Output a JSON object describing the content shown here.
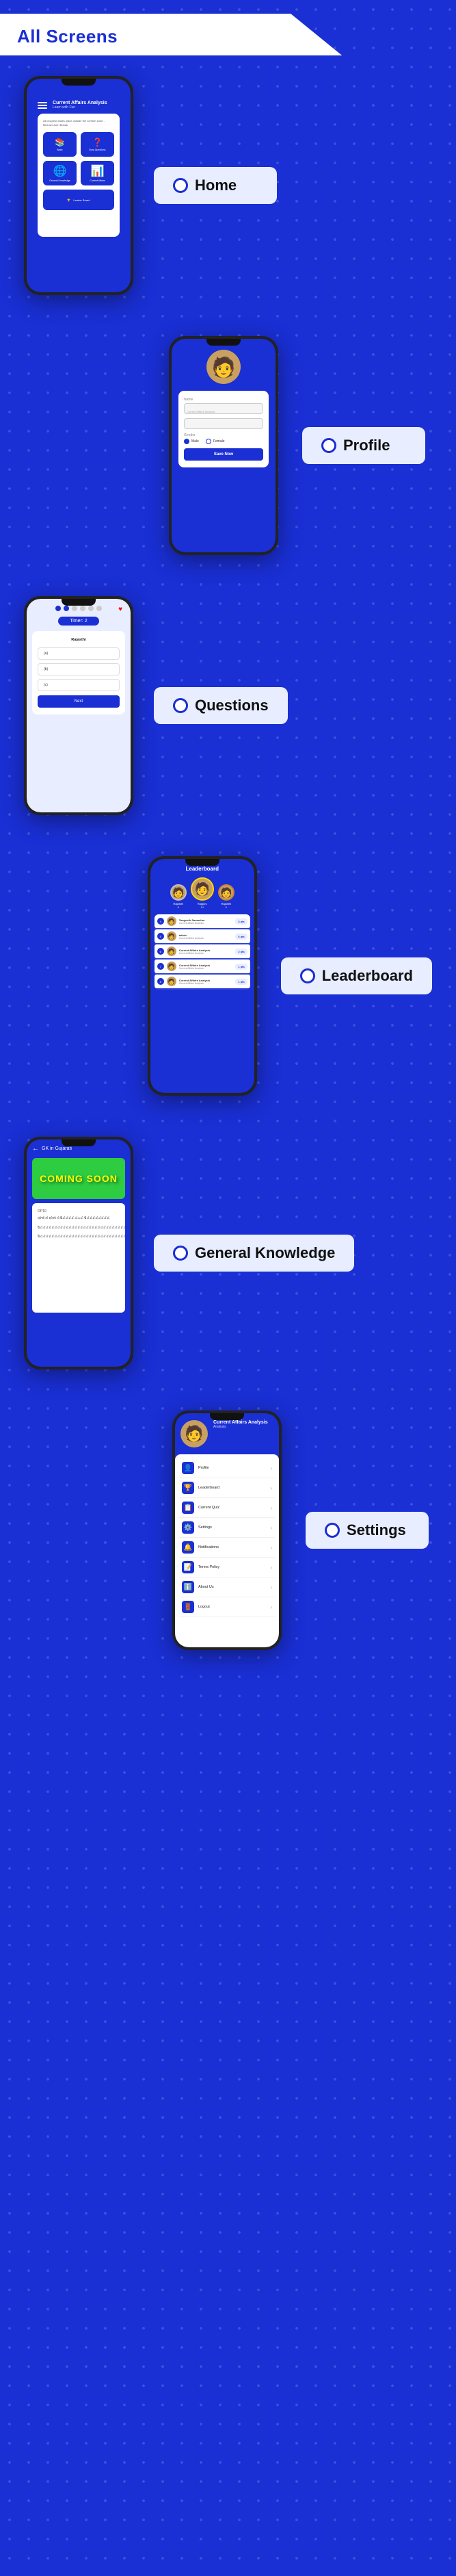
{
  "page": {
    "title": "All Screens",
    "background_color": "#1a2fd4"
  },
  "header": {
    "title": "All Screens"
  },
  "sections": {
    "home": {
      "label": "Home",
      "screen": {
        "title": "Current Affairs Analysis",
        "subtitle": "Learn with Fun",
        "quote": "All progress takes place outside the comfort zone. - Michael John Bobak",
        "menu_items": [
          {
            "icon": "📚",
            "label": "Basic"
          },
          {
            "icon": "❓",
            "label": "Bury Questions"
          },
          {
            "icon": "🌐",
            "label": "General Knowledge"
          },
          {
            "icon": "📊",
            "label": "Current Affairs"
          }
        ],
        "leaderboard_label": "Leader Board"
      }
    },
    "profile": {
      "label": "Profile",
      "screen": {
        "avatar_emoji": "🧑",
        "fields": [
          {
            "label": "Name",
            "placeholder": "Current Affairs Analysis"
          },
          {
            "label": "",
            "placeholder": ""
          }
        ],
        "gender_label": "Gender",
        "gender_options": [
          "Male",
          "Female"
        ],
        "save_button": "Save Now"
      }
    },
    "questions": {
      "label": "Questions",
      "screen": {
        "progress_dots": 6,
        "active_dot": 2,
        "timer": "Timer: 2",
        "question_text": "Rajasthi",
        "options": [
          "(a)",
          "(b)",
          "(c)"
        ],
        "next_button": "Next"
      }
    },
    "leaderboard": {
      "label": "Leaderboard",
      "screen": {
        "title": "Leaderboard",
        "top3": [
          {
            "rank": 2,
            "name": "Rajasthi Samachar",
            "score": "8",
            "emoji": "🧑"
          },
          {
            "rank": 1,
            "name": "Rajguru12345678",
            "score": "14",
            "emoji": "🧑"
          },
          {
            "rank": 3,
            "name": "Rajasthi Samachar",
            "score": "5",
            "emoji": "🧑"
          }
        ],
        "list": [
          {
            "rank": "4",
            "name": "Tangeeth Samachar",
            "sub": "Current Affairs Analysis",
            "score": "3 pts",
            "emoji": "🧑"
          },
          {
            "rank": "5",
            "name": "admin",
            "sub": "Current Affairs Analysis",
            "score": "6 pts",
            "emoji": "🧑"
          },
          {
            "rank": "6",
            "name": "Current Affairs Analysis",
            "sub": "Current Affairs Analysis",
            "score": "2 pts",
            "emoji": "🧑"
          },
          {
            "rank": "7",
            "name": "Current Affairs Analysis",
            "sub": "Current Affairs Analysis",
            "score": "1 pts",
            "emoji": "🧑"
          },
          {
            "rank": "8",
            "name": "Current Affairs Analysis",
            "sub": "Current Affairs Analysis",
            "score": "1 pts",
            "emoji": "🧑"
          }
        ]
      }
    },
    "general_knowledge": {
      "label": "General Knowledge",
      "screen": {
        "back_label": "←",
        "title": "GK in Gujarati",
        "coming_soon_text": "COMING SOON",
        "content": "સ્ત્રીઓ નો સ્ત્રીઓ સ્ત્રોત્ ગ્ ઉ.ગ.ઇ.ગ.ઇ.ગ. ઈ ઉ ઈ.ઈ.ઈ.ઈ.ઈ.ઈ.ઈ.ઈ.ઈ.ઈ.ઈ.ઈ.ઈ.ઈ.ઈ.ઈ.ઈ.ઈ.ઈ.ઈ.ઈ.ઈ.ઈ. ઉ ઈ.ઇ.ઈ.ઈ.ઈ.ઈ.ઈ.ઈ.ઈ.ઈ.ઈ.ઈ.ઈ.ઈ.ઈ.ઈ.ઈ.ઈ.ઈ.ઈ.ઈ.ઈ.ઈ.ઈ.ઈ.ઈ.ઈ.ઈ.ઈ.ઈ.ઈ.ઈ.ઈ.ઈ.ઈ.ઈ.ઈ.ઈ.ઈ.ઈ.ઈ.ઈ.ઈ.ઈ.ઈ.ઈ.ઈ.ઈ.ઈ.ઈ.ઈ.ઈ.ઈ.ઈ.ઈ.ઈ.ઈ.ઈ.ઈ.ઈ.ઈ."
      }
    },
    "settings": {
      "label": "Settings",
      "screen": {
        "username": "Current Affairs Analysis",
        "app_name": "Analysis",
        "avatar_emoji": "🧑",
        "menu_items": [
          {
            "icon": "👤",
            "label": "Profile"
          },
          {
            "icon": "🏆",
            "label": "Leaderboard"
          },
          {
            "icon": "📋",
            "label": "Current Quiz"
          },
          {
            "icon": "⚙️",
            "label": "Settings"
          },
          {
            "icon": "🔔",
            "label": "Notifications"
          },
          {
            "icon": "📝",
            "label": "Terms Policy"
          },
          {
            "icon": "ℹ️",
            "label": "About Us"
          },
          {
            "icon": "🚪",
            "label": "Logout"
          }
        ]
      }
    }
  }
}
